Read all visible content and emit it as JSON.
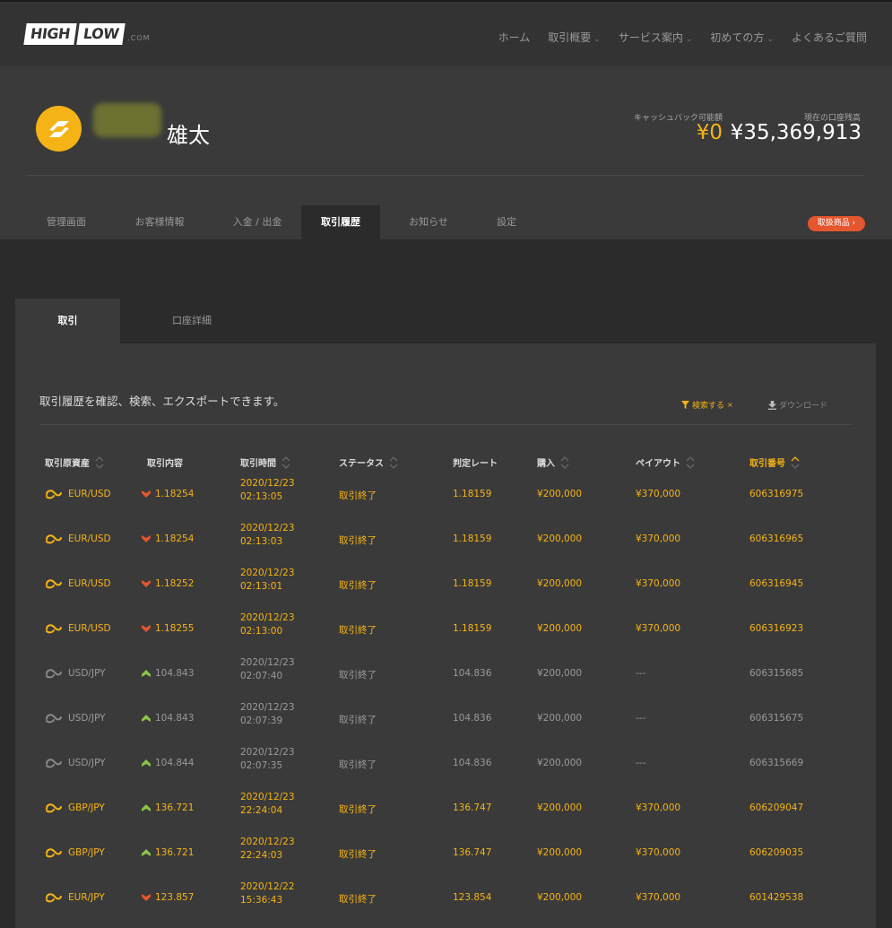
{
  "header": {
    "logo_high": "HIGH",
    "logo_low": "LOW",
    "logo_com": ".COM",
    "nav": [
      {
        "label": "ホーム",
        "has_dropdown": false
      },
      {
        "label": "取引概要",
        "has_dropdown": true
      },
      {
        "label": "サービス案内",
        "has_dropdown": true
      },
      {
        "label": "初めての方",
        "has_dropdown": true
      },
      {
        "label": "よくあるご質問",
        "has_dropdown": false
      }
    ]
  },
  "account": {
    "username": "雄太",
    "cashback_label": "キャッシュバック可能額",
    "cashback_value": "¥0",
    "balance_label": "現在の口座残高",
    "balance_value": "¥35,369,913",
    "tabs": [
      "管理画面",
      "お客様情報",
      "入金 / 出金",
      "取引履歴",
      "お知らせ",
      "設定"
    ],
    "active_tab": 3,
    "products_button": "取扱商品 ›"
  },
  "content_tabs": [
    "取引",
    "口座詳細"
  ],
  "panel": {
    "description": "取引履歴を確認、検索、エクスポートできます。",
    "search_label": "検索する",
    "search_close": "×",
    "download_label": "ダウンロード"
  },
  "table": {
    "headers": [
      "取引原資産",
      "取引内容",
      "取引時間",
      "ステータス",
      "判定レート",
      "購入",
      "ペイアウト",
      "取引番号"
    ],
    "rows": [
      {
        "asset": "EUR/USD",
        "direction": "down",
        "strike": "1.18254",
        "date": "2020/12/23",
        "time": "02:13:05",
        "status": "取引終了",
        "rate": "1.18159",
        "purchase": "¥200,000",
        "payout": "¥370,000",
        "id": "606316975",
        "won": true
      },
      {
        "asset": "EUR/USD",
        "direction": "down",
        "strike": "1.18254",
        "date": "2020/12/23",
        "time": "02:13:03",
        "status": "取引終了",
        "rate": "1.18159",
        "purchase": "¥200,000",
        "payout": "¥370,000",
        "id": "606316965",
        "won": true
      },
      {
        "asset": "EUR/USD",
        "direction": "down",
        "strike": "1.18252",
        "date": "2020/12/23",
        "time": "02:13:01",
        "status": "取引終了",
        "rate": "1.18159",
        "purchase": "¥200,000",
        "payout": "¥370,000",
        "id": "606316945",
        "won": true
      },
      {
        "asset": "EUR/USD",
        "direction": "down",
        "strike": "1.18255",
        "date": "2020/12/23",
        "time": "02:13:00",
        "status": "取引終了",
        "rate": "1.18159",
        "purchase": "¥200,000",
        "payout": "¥370,000",
        "id": "606316923",
        "won": true
      },
      {
        "asset": "USD/JPY",
        "direction": "up",
        "strike": "104.843",
        "date": "2020/12/23",
        "time": "02:07:40",
        "status": "取引終了",
        "rate": "104.836",
        "purchase": "¥200,000",
        "payout": "---",
        "id": "606315685",
        "won": false
      },
      {
        "asset": "USD/JPY",
        "direction": "up",
        "strike": "104.843",
        "date": "2020/12/23",
        "time": "02:07:39",
        "status": "取引終了",
        "rate": "104.836",
        "purchase": "¥200,000",
        "payout": "---",
        "id": "606315675",
        "won": false
      },
      {
        "asset": "USD/JPY",
        "direction": "up",
        "strike": "104.844",
        "date": "2020/12/23",
        "time": "02:07:35",
        "status": "取引終了",
        "rate": "104.836",
        "purchase": "¥200,000",
        "payout": "---",
        "id": "606315669",
        "won": false
      },
      {
        "asset": "GBP/JPY",
        "direction": "up",
        "strike": "136.721",
        "date": "2020/12/23",
        "time": "22:24:04",
        "status": "取引終了",
        "rate": "136.747",
        "purchase": "¥200,000",
        "payout": "¥370,000",
        "id": "606209047",
        "won": true
      },
      {
        "asset": "GBP/JPY",
        "direction": "up",
        "strike": "136.721",
        "date": "2020/12/23",
        "time": "22:24:03",
        "status": "取引終了",
        "rate": "136.747",
        "purchase": "¥200,000",
        "payout": "¥370,000",
        "id": "606209035",
        "won": true
      },
      {
        "asset": "EUR/JPY",
        "direction": "down",
        "strike": "123.857",
        "date": "2020/12/22",
        "time": "15:36:43",
        "status": "取引終了",
        "rate": "123.854",
        "purchase": "¥200,000",
        "payout": "¥370,000",
        "id": "601429538",
        "won": true
      }
    ]
  },
  "colors": {
    "accent": "#f5b316",
    "down": "#e4562e",
    "up": "#8bc34a",
    "products_button": "#e4562e"
  },
  "icons": {
    "avatar": "highlow-logo-icon",
    "asset": "currency-pair-icon",
    "down": "arrow-down-icon",
    "up": "arrow-up-icon",
    "filter": "filter-icon",
    "download": "download-icon",
    "sort": "sort-icon"
  }
}
